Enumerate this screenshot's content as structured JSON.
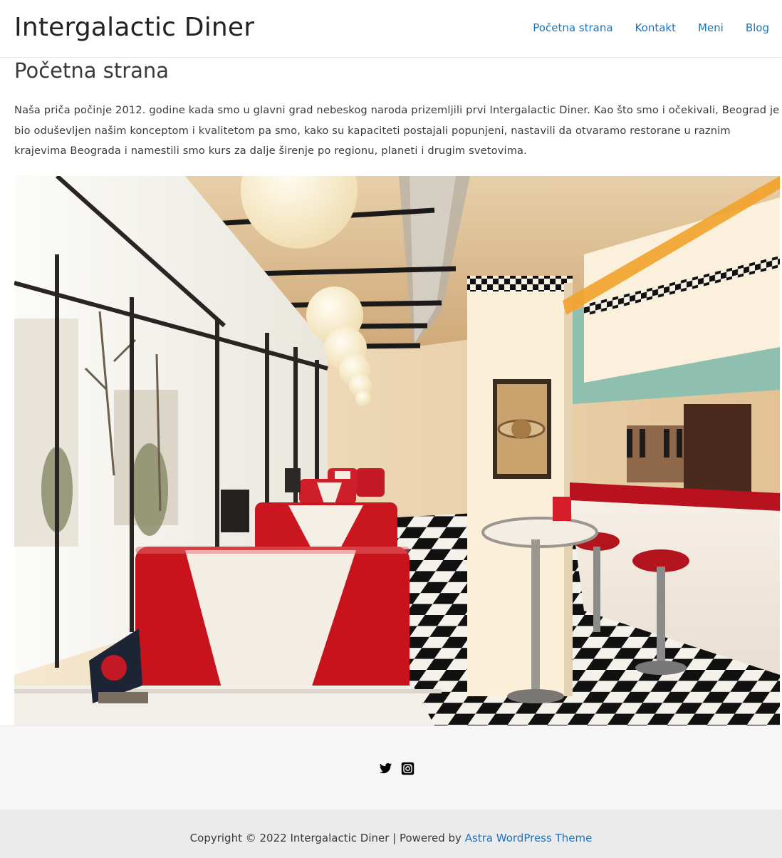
{
  "header": {
    "site_title": "Intergalactic Diner",
    "nav": [
      {
        "label": "Početna strana"
      },
      {
        "label": "Kontakt"
      },
      {
        "label": "Meni"
      },
      {
        "label": "Blog"
      }
    ]
  },
  "main": {
    "page_title": "Početna strana",
    "intro": "Naša priča počinje 2012. godine kada smo u glavni grad nebeskog naroda prizemljili prvi Intergalactic Diner. Kao što smo i očekivali, Beograd je bio oduševljen našim konceptom i kvalitetom pa smo, kako su kapaciteti postajali popunjeni, nastavili da otvaramo restorane u raznim krajevima Beograda i namestili smo kurs za dalje širenje po regionu, planeti i drugim svetovima.",
    "hero_image": "diner-interior-photo"
  },
  "footer": {
    "social_icons": [
      "twitter-icon",
      "instagram-icon"
    ],
    "copyright_prefix": "Copyright © 2022 Intergalactic Diner | Powered by ",
    "theme_link": "Astra WordPress Theme"
  },
  "colors": {
    "link": "#1e73be",
    "text": "#3a3a3a",
    "footer_widgets_bg": "#f7f7f7",
    "footer_bar_bg": "#ebebeb"
  }
}
